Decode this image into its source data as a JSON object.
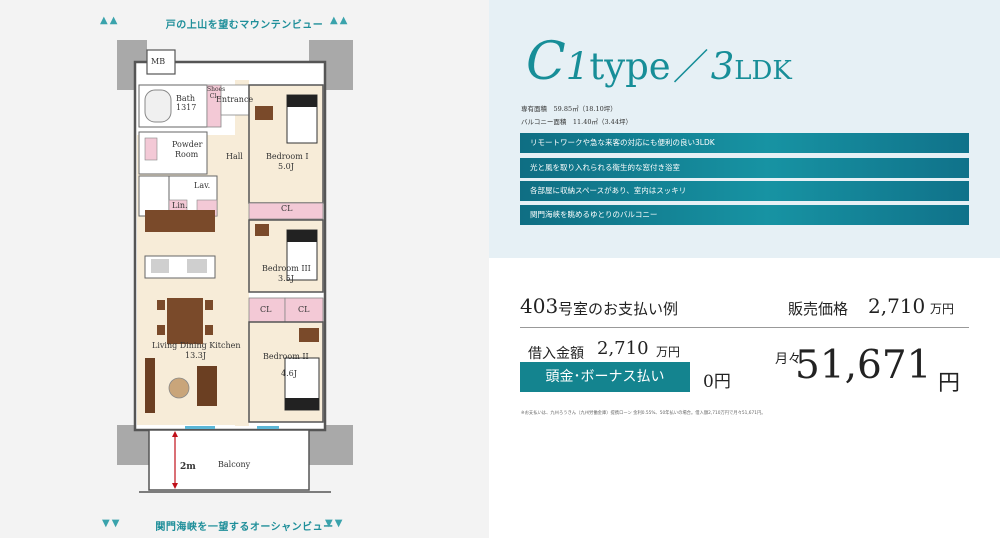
{
  "views": {
    "top": "戸の上山を望むマウンテンビュー",
    "bottom": "関門海峡を一望するオーシャンビュー"
  },
  "plan": {
    "mb": "MB",
    "bath": "Bath",
    "bath_size": "1317",
    "shoes": "Shoes Cl.",
    "entrance": "Entrance",
    "powder": "Powder",
    "powder2": "Room",
    "hall": "Hall",
    "lav": "Lav.",
    "lin": "Lin.",
    "bed1": "Bedroom I",
    "bed1_size": "5.0J",
    "bed3": "Bedroom III",
    "bed3_size": "3.5J",
    "bed2": "Bedroom II",
    "bed2_size": "4.6J",
    "ldk": "Living Dining Kitchen",
    "ldk_size": "13.3J",
    "cl1": "CL",
    "cl2": "CL",
    "cl3": "CL",
    "balcony": "Balcony",
    "dim": "2m"
  },
  "type": {
    "c": "C",
    "one": "1",
    "type_word": "type",
    "slash": "／",
    "num": "3",
    "ldk": "LDK"
  },
  "area": {
    "exclusive": "専有面積　59.85㎡（18.10坪）",
    "balcony": "バルコニー面積　11.40㎡（3.44坪）"
  },
  "features": [
    "リモートワークや急な来客の対応にも便利の良い3LDK",
    "光と風を取り入れられる衛生的な窓付き浴室",
    "各部屋に収納スペースがあり、室内はスッキリ",
    "関門海峡を眺めるゆとりのバルコニー"
  ],
  "payment": {
    "room_num": "403",
    "room_label": "号室のお支払い例",
    "price_label": "販売価格",
    "price": "2,710",
    "price_unit": "万円",
    "loan_label": "借入金額",
    "loan": "2,710",
    "loan_unit": "万円",
    "bonus_label": "頭金･ボーナス払い",
    "bonus_value": "0円",
    "monthly_label": "月々",
    "monthly": "51,671",
    "monthly_unit": "円",
    "note": "※お支払いは、九州ろうきん（九州労働金庫）提携ローン 金利0.55%、50年払いの場合。借入額2,710万円で月々51,671円。"
  },
  "colors": {
    "accent": "#178e98",
    "panel_bg": "#e6f0f5",
    "bar": "#14848f"
  }
}
